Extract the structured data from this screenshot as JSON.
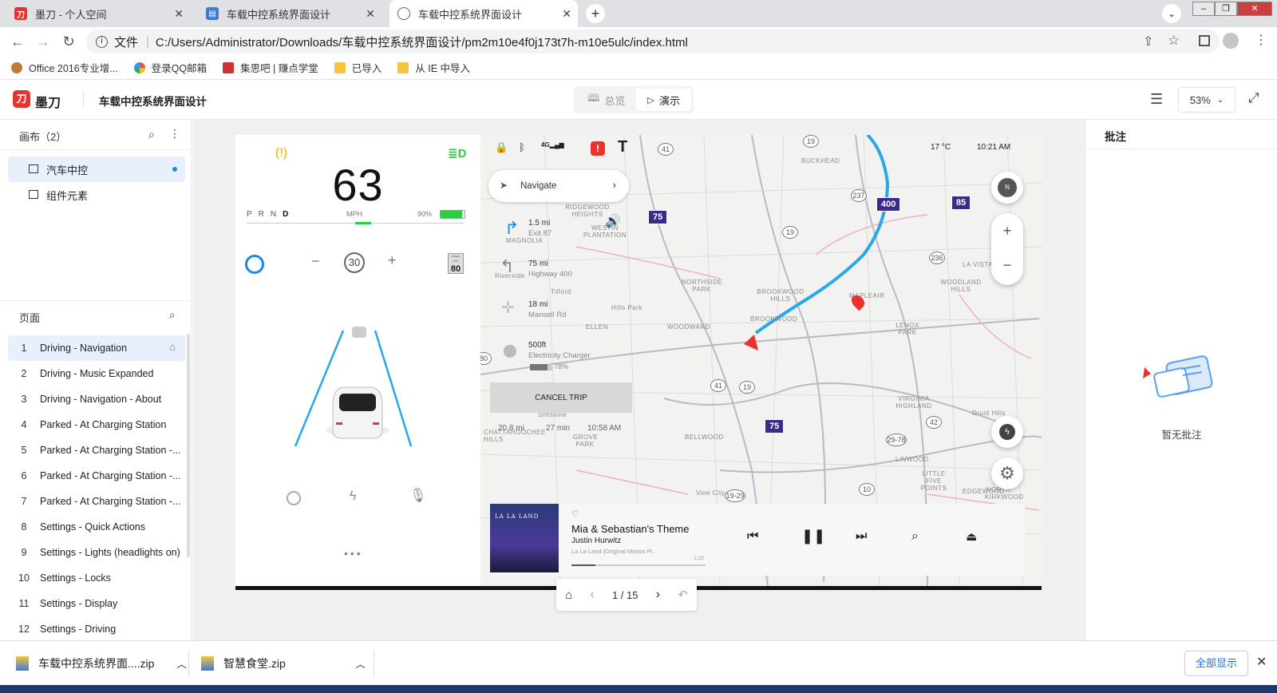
{
  "browser": {
    "tabs": [
      {
        "title": "墨刀 - 个人空间",
        "active": false
      },
      {
        "title": "车载中控系统界面设计",
        "active": false
      },
      {
        "title": "车载中控系统界面设计",
        "active": true
      }
    ],
    "security_label": "文件",
    "url": "C:/Users/Administrator/Downloads/车载中控系统界面设计/pm2m10e4f0j173t7h-m10e5ulc/index.html",
    "bookmarks": [
      "Office 2016专业增...",
      "登录QQ邮箱",
      "集思吧 | 赚点学堂",
      "已导入",
      "从 IE 中导入"
    ]
  },
  "app": {
    "logo": "墨刀",
    "project_title": "车载中控系统界面设计",
    "modes": [
      "总览",
      "演示"
    ],
    "active_mode": "演示",
    "zoom": "53%"
  },
  "left_panel": {
    "canvas_title": "画布（2）",
    "canvases": [
      "汽车中控",
      "组件元素"
    ],
    "pages_title": "页面",
    "pages": [
      {
        "num": "1",
        "name": "Driving - Navigation"
      },
      {
        "num": "2",
        "name": "Driving - Music Expanded"
      },
      {
        "num": "3",
        "name": "Driving - Navigation - About"
      },
      {
        "num": "4",
        "name": "Parked - At Charging Station"
      },
      {
        "num": "5",
        "name": "Parked - At Charging Station -..."
      },
      {
        "num": "6",
        "name": "Parked - At Charging Station -..."
      },
      {
        "num": "7",
        "name": "Parked - At Charging Station -..."
      },
      {
        "num": "8",
        "name": "Settings - Quick Actions"
      },
      {
        "num": "9",
        "name": "Settings - Lights (headlights on)"
      },
      {
        "num": "10",
        "name": "Settings - Locks"
      },
      {
        "num": "11",
        "name": "Settings - Display"
      },
      {
        "num": "12",
        "name": "Settings - Driving"
      }
    ]
  },
  "car": {
    "speed": "63",
    "gears": [
      "P",
      "R",
      "N",
      "D"
    ],
    "active_gear": "D",
    "speed_unit": "MPH",
    "battery": "90%",
    "battery_level": 0.9,
    "cruise_speed": "30",
    "speed_limit_label": "SPEED LIMIT",
    "speed_limit": "80",
    "minus": "−",
    "plus": "+"
  },
  "map_ui": {
    "status_4g": "4G",
    "temperature": "17 °C",
    "time": "10:21 AM",
    "navigate": "Navigate",
    "steps": [
      {
        "dist": "1.5 mi",
        "desc": "Exit 87"
      },
      {
        "dist": "75 mi",
        "desc": "Highway 400"
      },
      {
        "dist": "18 mi",
        "desc": "Mansell Rd"
      },
      {
        "dist": "500ft",
        "desc": "Electricity Charger"
      }
    ],
    "charger_pct": "78%",
    "charger_level": 0.78,
    "cancel": "CANCEL TRIP",
    "trip_dist": "20.8 mi",
    "trip_min": "27 min",
    "eta": "10:58 AM",
    "compass": "N",
    "zoom_in": "+",
    "zoom_out": "−",
    "shields": [
      "75",
      "400",
      "85",
      "75"
    ],
    "routes": [
      "19",
      "41",
      "237",
      "19",
      "236",
      "41",
      "19",
      "42",
      "29-78",
      "10",
      "19-29",
      "80"
    ],
    "places": [
      "BUCKHEAD",
      "RIDGEWOOD HEIGHTS",
      "WESTIN PLANTATION",
      "MAGNOLIA",
      "NORTHSIDE PARK",
      "BROOKWOOD HILLS",
      "BROOKWOOD",
      "WOODWARD",
      "Riverside",
      "Tilford",
      "Hills Park",
      "ELLEN",
      "MAPLEAIR",
      "LENOX PARK",
      "WOODLAND HILLS",
      "LA VISTA",
      "VIRGINIA HIGHLAND",
      "Druid Hills",
      "BELLWOOD",
      "LINWOOD",
      "LITTLE FIVE POINTS",
      "EDGEWOOD",
      "NORTH KIRKWOOD",
      "Vine City",
      "Simsville",
      "GROVE PARK",
      "CHATTAHOOCHEE HILLS"
    ]
  },
  "music": {
    "album": "LA LA LAND",
    "title": "Mia & Sebastian's Theme",
    "artist": "Justin Hurwitz",
    "album_full": "La La Land (Original Motion Pi...",
    "remaining": "-1:23",
    "progress": 0.18
  },
  "pager": {
    "text": "1 / 15"
  },
  "right_panel": {
    "title": "批注",
    "empty": "暂无批注"
  },
  "downloads": {
    "items": [
      "车载中控系统界面....zip",
      "智慧食堂.zip"
    ],
    "show_all": "全部显示"
  },
  "colors": {
    "accent": "#1e88e5",
    "route": "#29a8e8",
    "battery": "#2ecc40",
    "shield": "#3b2a8a",
    "logo": "#e8322d"
  }
}
